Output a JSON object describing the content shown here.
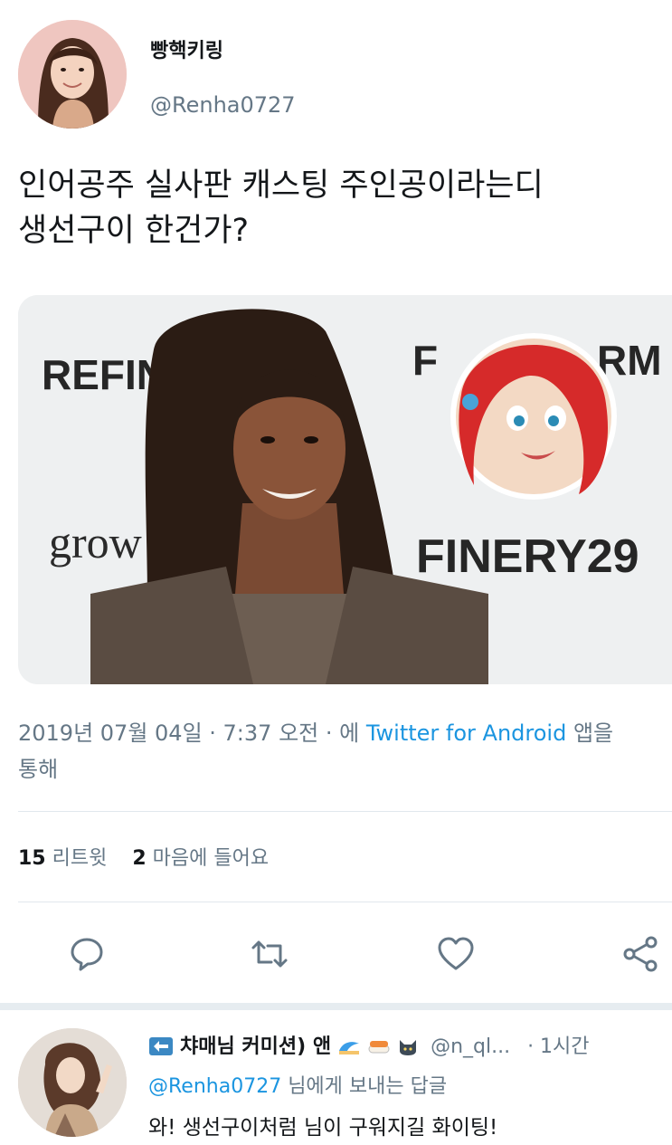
{
  "tweet": {
    "display_name": "빵핵키링",
    "handle": "@Renha0727",
    "text_lines": [
      "인어공주 실사판 캐스팅 주인공이라는디",
      "생선구이 한건가?"
    ],
    "media": {
      "backdrop_words": [
        "REFINE",
        "F",
        "RM",
        "grow",
        "FINERY29"
      ]
    },
    "timestamp": "2019년 07월 04일 · 7:37 오전 · 에",
    "source": "Twitter for Android",
    "source_suffix": "앱을",
    "source_suffix_line2": "통해",
    "retweets_count": "15",
    "retweets_label": "리트윗",
    "likes_count": "2",
    "likes_label": "마음에 들어요"
  },
  "actions": {
    "icons": [
      "reply-icon",
      "retweet-icon",
      "like-icon",
      "share-icon"
    ]
  },
  "reply": {
    "name": "챠매님 커미션) 앤",
    "handle": "@n_ql...",
    "time": "· 1시간",
    "to_prefix": "",
    "to_mention": "@Renha0727",
    "to_suffix": " 님에게 보내는 답글",
    "text": "와! 생선구이처럼 님이 구워지길 화이팅!"
  },
  "colors": {
    "text_primary": "#14171a",
    "text_secondary": "#657786",
    "link": "#1b95e0",
    "divider": "#e1e8ed"
  }
}
